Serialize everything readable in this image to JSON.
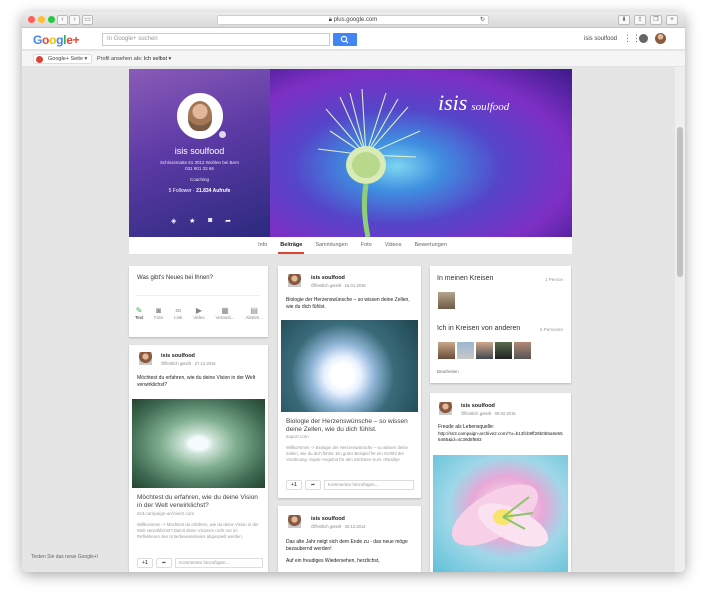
{
  "browser": {
    "url": "plus.google.com",
    "back": "‹",
    "forward": "›",
    "reload": "↻",
    "colors": {
      "close": "#ff5f57",
      "min": "#febc2e",
      "max": "#28c840"
    }
  },
  "header": {
    "logo": "Google+",
    "search_placeholder": "In Google+ suchen",
    "user": "isis soulfood"
  },
  "subbar": {
    "page_label": "Google+ Seite",
    "view_as_label": "Profil ansehen als:",
    "view_as_value": "Ich selbst"
  },
  "cover": {
    "name": "isis soulfood",
    "address": "Schlossmatte 61 3012 Wohlen bei Bern",
    "phone": "031 901 33 66",
    "category": "Coaching",
    "followers": "5 Follower",
    "views": "21.834 Aufrufe",
    "brand_logo": "isis",
    "brand_text": "soulfood"
  },
  "tabs": [
    {
      "label": "Info",
      "active": false
    },
    {
      "label": "Beiträge",
      "active": true
    },
    {
      "label": "Sammlungen",
      "active": false
    },
    {
      "label": "Foto",
      "active": false
    },
    {
      "label": "Videos",
      "active": false
    },
    {
      "label": "Bewertungen",
      "active": false
    }
  ],
  "compose": {
    "prompt": "Was gibt's Neues bei Ihnen?",
    "tools": [
      "Text",
      "Foto",
      "Link",
      "Video",
      "Veranst...",
      "Abstim..."
    ]
  },
  "posts": [
    {
      "author": "isis soulfood",
      "meta": "Öffentlich geteilt · 27.12.2015",
      "text": "Möchtest du erfahren, wie du deine Vision in der Welt verwirklichst?",
      "headline": "Möchtest du erfahren, wie du deine Vision in der Welt verwirklichst?",
      "source": "ss3.campaign-archive2.com",
      "desc": "Willkommen -> Möchtest du erfahren, wie du deine Vision in der Welt verwirklichst? Damit deine Visionen nicht nur im Reflektieren des Unterbewusstseins abgespielt werden.",
      "plus": "+1",
      "comment_placeholder": "Kommentar hinzufügen..."
    },
    {
      "author": "isis soulfood",
      "meta": "Öffentlich geteilt · 16.01.2016",
      "text": "Biologie der Herzenswünsche – so wissen deine Zellen, wie du dich fühlst.",
      "headline": "Biologie der Herzenswünsche – so wissen deine Zellen, wie du dich fühlst.",
      "source": "saport.com",
      "desc": "Willkommen -> Biologie der Herzenswünsche – so wissen deine Zellen, wie du dich fühlst. Ein gutes Beispiel für ein Gefühl der Vorahnung. Super-Angebot für den nächsten Kurs «Reality»",
      "plus": "+1",
      "comment_placeholder": "Kommentar hinzufügen..."
    },
    {
      "author": "isis soulfood",
      "meta": "Öffentlich geteilt · 30.12.2014",
      "text": "Das alte Jahr neigt sich dem Ende zu - das neue möge bezaubernd werden!",
      "text2": "Auf ein freudiges Wiedersehen, herzlichst,"
    },
    {
      "author": "isis soulfood",
      "meta": "Öffentlich geteilt · 09.02.2015",
      "text": "Freude als Lebensquelle:",
      "link": "http://ss3.campaign-archive2.com/?u=b13fcb9ff26b0b5a6e555485&id=4c39d8f683"
    }
  ],
  "circles": {
    "in_my_circles_title": "In meinen Kreisen",
    "in_my_circles_count": "1 Person",
    "in_others_title": "Ich in Kreisen von anderen",
    "in_others_count": "5 Personen",
    "edit": "Bearbeiten"
  },
  "footer": {
    "try_new": "Testen Sie das neue Google+!"
  }
}
